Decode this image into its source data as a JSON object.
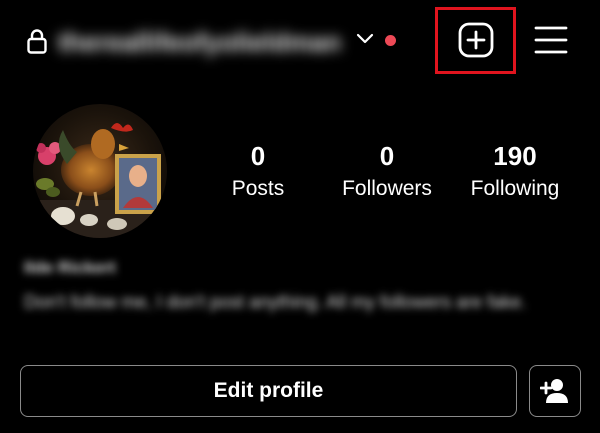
{
  "header": {
    "username": "thereallifeofyolieldman",
    "lock_icon": "lock-icon",
    "dropdown_icon": "chevron-down-icon",
    "create_icon": "plus-square-icon",
    "menu_icon": "hamburger-menu-icon"
  },
  "profile": {
    "avatar_icon": "avatar",
    "stats": [
      {
        "value": "0",
        "label": "Posts"
      },
      {
        "value": "0",
        "label": "Followers"
      },
      {
        "value": "190",
        "label": "Following"
      }
    ],
    "display_name": "Ilde Rickert",
    "bio": "Don't follow me, I don't post anything. All my followers are fake."
  },
  "actions": {
    "edit_profile_label": "Edit profile",
    "discover_icon": "add-person-icon"
  },
  "colors": {
    "background": "#000000",
    "text": "#ffffff",
    "notification_dot": "#ed4956",
    "highlight_box": "#e0141e",
    "button_border": "#8a8a8a"
  }
}
